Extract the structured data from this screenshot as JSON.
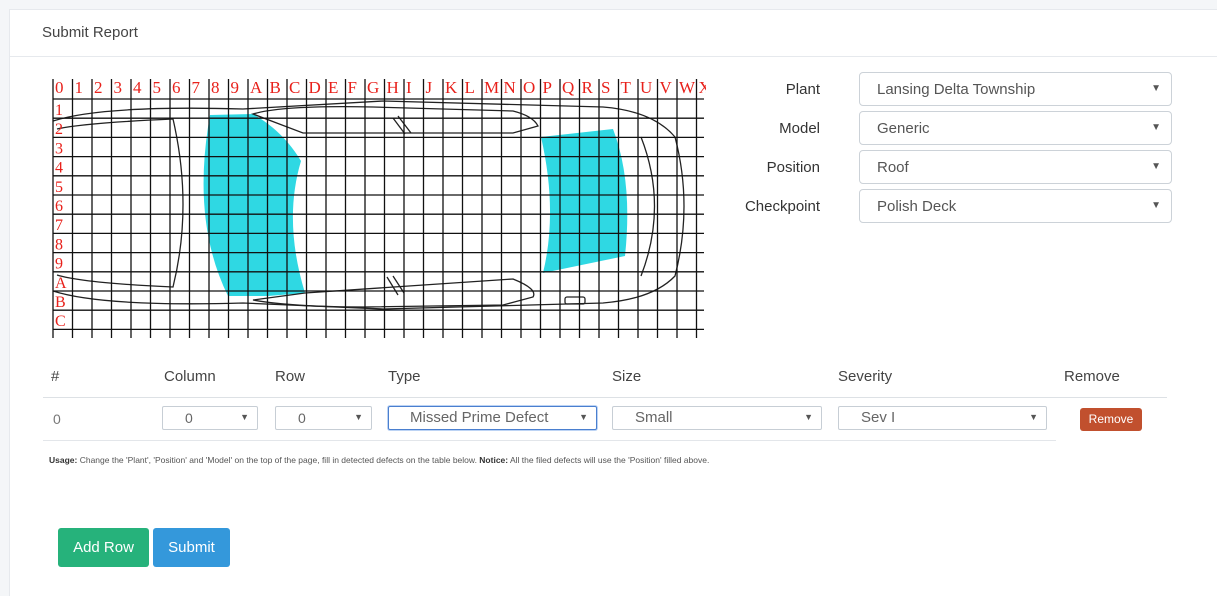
{
  "header": {
    "title": "Submit Report"
  },
  "grid": {
    "column_labels": [
      "0",
      "1",
      "2",
      "3",
      "4",
      "5",
      "6",
      "7",
      "8",
      "9",
      "A",
      "B",
      "C",
      "D",
      "E",
      "F",
      "G",
      "H",
      "I",
      "J",
      "K",
      "L",
      "M",
      "N",
      "O",
      "P",
      "Q",
      "R",
      "S",
      "T",
      "U",
      "V",
      "W",
      "X"
    ],
    "row_labels": [
      "1",
      "2",
      "3",
      "4",
      "5",
      "6",
      "7",
      "8",
      "9",
      "A",
      "B",
      "C"
    ],
    "corner_label": "0",
    "label_color": "#e8211b",
    "highlight_color": "#2fd8e3"
  },
  "form": {
    "plant": {
      "label": "Plant",
      "value": "Lansing Delta Township"
    },
    "model": {
      "label": "Model",
      "value": "Generic"
    },
    "position": {
      "label": "Position",
      "value": "Roof"
    },
    "checkpoint": {
      "label": "Checkpoint",
      "value": "Polish Deck"
    }
  },
  "table": {
    "headers": {
      "num": "#",
      "column": "Column",
      "row": "Row",
      "type": "Type",
      "size": "Size",
      "severity": "Severity",
      "remove": "Remove"
    },
    "rows": [
      {
        "num": "0",
        "column": "0",
        "row": "0",
        "type": "Missed Prime Defect",
        "size": "Small",
        "severity": "Sev I",
        "remove_label": "Remove"
      }
    ]
  },
  "usage": {
    "label": "Usage:",
    "text": " Change the 'Plant', 'Position' and 'Model' on the top of the page, fill in detected defects on the table below. ",
    "notice_label": "Notice:",
    "notice_text": " All the filed defects will use the 'Position' filled above."
  },
  "actions": {
    "add_row": "Add Row",
    "submit": "Submit"
  },
  "colors": {
    "remove": "#c1502e",
    "add_row": "#26b27b",
    "submit": "#3498db"
  }
}
